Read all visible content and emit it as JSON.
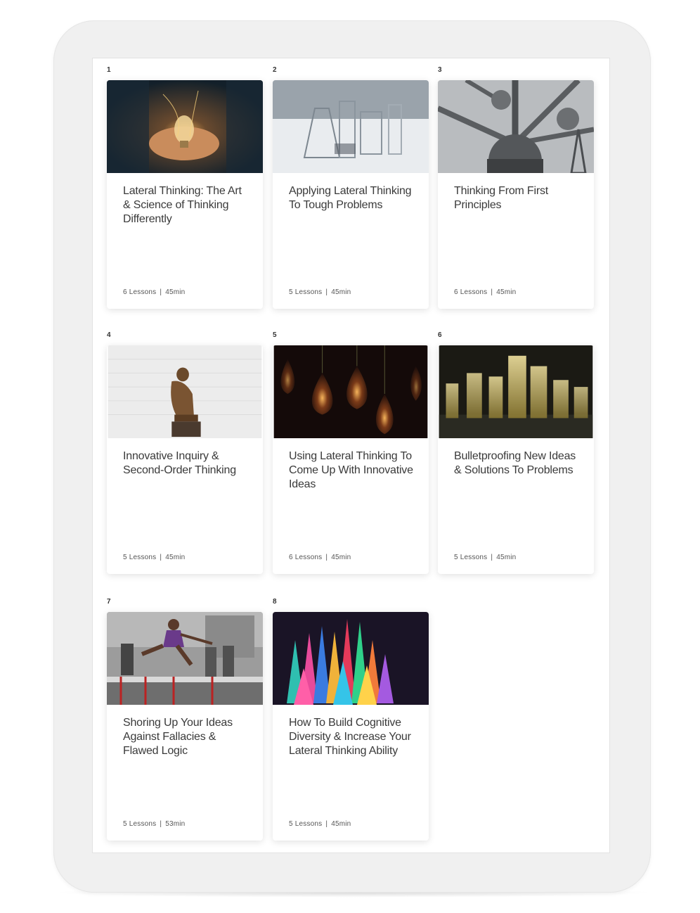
{
  "courses": [
    {
      "number": "1",
      "title": "Lateral Thinking: The Art & Science of Thinking Differently",
      "lessons": "6 Lessons",
      "duration": "45min",
      "image": "hands-lightbulb-image"
    },
    {
      "number": "2",
      "title": "Applying Lateral Thinking To Tough Problems",
      "lessons": "5 Lessons",
      "duration": "45min",
      "image": "lab-glassware-image"
    },
    {
      "number": "3",
      "title": "Thinking From First Principles",
      "lessons": "6 Lessons",
      "duration": "45min",
      "image": "atomium-structure-image"
    },
    {
      "number": "4",
      "title": "Innovative Inquiry & Second-Order Thinking",
      "lessons": "5 Lessons",
      "duration": "45min",
      "image": "thinker-statue-image"
    },
    {
      "number": "5",
      "title": "Using Lateral Thinking To Come Up With Innovative Ideas",
      "lessons": "6 Lessons",
      "duration": "45min",
      "image": "glowing-bulbs-image"
    },
    {
      "number": "6",
      "title": "Bulletproofing New Ideas & Solutions To Problems",
      "lessons": "5 Lessons",
      "duration": "45min",
      "image": "glass-blocks-image"
    },
    {
      "number": "7",
      "title": "Shoring Up Your Ideas Against Fallacies & Flawed Logic",
      "lessons": "5 Lessons",
      "duration": "53min",
      "image": "hurdler-image"
    },
    {
      "number": "8",
      "title": "How To Build Cognitive Diversity & Increase Your Lateral Thinking Ability",
      "lessons": "5 Lessons",
      "duration": "45min",
      "image": "colored-pencils-image"
    }
  ],
  "separator": "|"
}
